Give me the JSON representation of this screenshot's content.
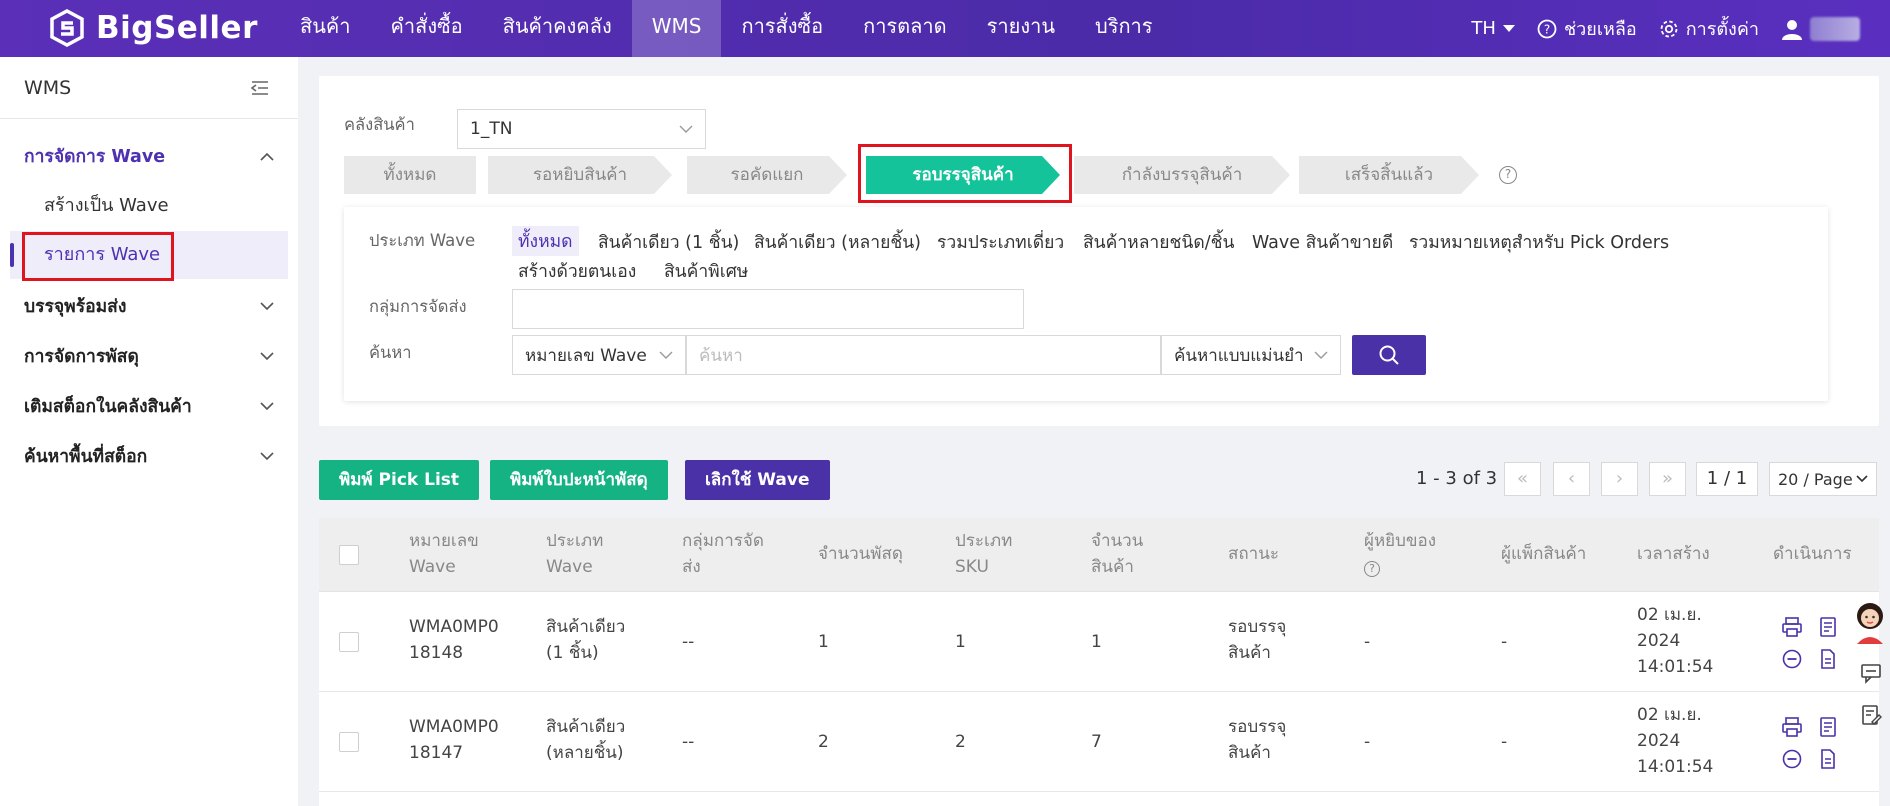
{
  "brand": {
    "name": "BigSeller"
  },
  "nav": {
    "items": [
      "สินค้า",
      "คำสั่งซื้อ",
      "สินค้าคงคลัง",
      "WMS",
      "การสั่งซื้อ",
      "การตลาด",
      "รายงาน",
      "บริการ"
    ],
    "active": "WMS"
  },
  "topright": {
    "lang": "TH",
    "help": "ช่วยเหลือ",
    "settings": "การตั้งค่า"
  },
  "sidebar": {
    "title": "WMS",
    "group_wave": "การจัดการ Wave",
    "sub_create": "สร้างเป็น Wave",
    "sub_list": "รายการ Wave",
    "group_pack": "บรรจุพร้อมส่ง",
    "group_parcel": "การจัดการพัสดุ",
    "group_restock": "เติมสต็อกในคลังสินค้า",
    "group_location": "ค้นหาพื้นที่สต็อก"
  },
  "filter": {
    "warehouse_label": "คลังสินค้า",
    "warehouse_value": "1_TN",
    "steps": [
      "ทั้งหมด",
      "รอหยิบสินค้า",
      "รอคัดแยก",
      "รอบรรจุสินค้า",
      "กำลังบรรจุสินค้า",
      "เสร็จสิ้นแล้ว"
    ],
    "wave_type_label": "ประเภท Wave",
    "wave_types": [
      "ทั้งหมด",
      "สินค้าเดียว (1 ชิ้น)",
      "สินค้าเดียว (หลายชิ้น)",
      "รวมประเภทเดี่ยว",
      "สินค้าหลายชนิด/ชิ้น",
      "Wave สินค้าขายดี",
      "รวมหมายเหตุสำหรับ Pick Orders",
      "สร้างด้วยตนเอง",
      "สินค้าพิเศษ"
    ],
    "ship_group_label": "กลุ่มการจัดส่ง",
    "search_label": "ค้นหา",
    "search_field": "หมายเลข Wave",
    "search_placeholder": "ค้นหา",
    "search_mode": "ค้นหาแบบแม่นยำ"
  },
  "actions": {
    "print_pick": "พิมพ์ Pick List",
    "print_label": "พิมพ์ใบปะหน้าพัสดุ",
    "cancel_wave": "เลิกใช้ Wave"
  },
  "pager": {
    "range": "1 - 3 of 3",
    "page": "1 / 1",
    "page_size": "20 / Page"
  },
  "table": {
    "headers": {
      "wave_no": [
        "หมายเลข",
        "Wave"
      ],
      "wave_type": [
        "ประเภท",
        "Wave"
      ],
      "ship_group": [
        "กลุ่มการจัด",
        "ส่ง"
      ],
      "parcel_qty": "จำนวนพัสดุ",
      "sku_type": [
        "ประเภท",
        "SKU"
      ],
      "item_qty": [
        "จำนวน",
        "สินค้า"
      ],
      "status": "สถานะ",
      "picker": "ผู้หยิบของ",
      "packer": "ผู้แพ็กสินค้า",
      "created": "เวลาสร้าง",
      "ops": "ดำเนินการ"
    },
    "rows": [
      {
        "wave_no": [
          "WMA0MP0",
          "18148"
        ],
        "wave_type": [
          "สินค้าเดียว",
          "(1 ชิ้น)"
        ],
        "ship_group": "--",
        "parcel_qty": "1",
        "sku_type": "1",
        "item_qty": "1",
        "status": [
          "รอบรรจุ",
          "สินค้า"
        ],
        "picker": "-",
        "packer": "-",
        "created": [
          "02 เม.ย.",
          "2024",
          "14:01:54"
        ]
      },
      {
        "wave_no": [
          "WMA0MP0",
          "18147"
        ],
        "wave_type": [
          "สินค้าเดียว",
          "(หลายชิ้น)"
        ],
        "ship_group": "--",
        "parcel_qty": "2",
        "sku_type": "2",
        "item_qty": "7",
        "status": [
          "รอบรรจุ",
          "สินค้า"
        ],
        "picker": "-",
        "packer": "-",
        "created": [
          "02 เม.ย.",
          "2024",
          "14:01:54"
        ]
      }
    ]
  },
  "colors": {
    "brand_purple": "#4e31b1",
    "active_green": "#15c39a",
    "highlight_red": "#e0141e"
  }
}
